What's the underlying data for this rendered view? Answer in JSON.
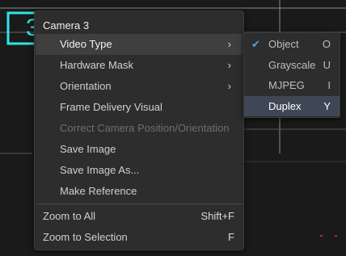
{
  "context_menu": {
    "title": "Camera 3",
    "items": [
      {
        "label": "Video Type",
        "has_submenu": true,
        "highlighted": true,
        "disabled": false
      },
      {
        "label": "Hardware Mask",
        "has_submenu": true,
        "highlighted": false,
        "disabled": false
      },
      {
        "label": "Orientation",
        "has_submenu": true,
        "highlighted": false,
        "disabled": false
      },
      {
        "label": "Frame Delivery Visual",
        "has_submenu": false,
        "highlighted": false,
        "disabled": false
      },
      {
        "label": "Correct Camera Position/Orientation",
        "has_submenu": false,
        "highlighted": false,
        "disabled": true
      },
      {
        "label": "Save Image",
        "has_submenu": false,
        "highlighted": false,
        "disabled": false
      },
      {
        "label": "Save Image As...",
        "has_submenu": false,
        "highlighted": false,
        "disabled": false
      },
      {
        "label": "Make Reference",
        "has_submenu": false,
        "highlighted": false,
        "disabled": false
      }
    ],
    "zoom_items": [
      {
        "label": "Zoom to All",
        "shortcut": "Shift+F"
      },
      {
        "label": "Zoom to Selection",
        "shortcut": "F"
      }
    ],
    "submenu_arrow": "›"
  },
  "video_type_submenu": {
    "items": [
      {
        "label": "Object",
        "key": "O",
        "checked": true,
        "highlighted": false
      },
      {
        "label": "Grayscale",
        "key": "U",
        "checked": false,
        "highlighted": false
      },
      {
        "label": "MJPEG",
        "key": "I",
        "checked": false,
        "highlighted": false
      },
      {
        "label": "Duplex",
        "key": "Y",
        "checked": false,
        "highlighted": true
      }
    ],
    "check_glyph": "✔"
  },
  "viewport": {
    "camera_badge_text": "3",
    "colors": {
      "background": "#1a1a1a",
      "grid": "#8a8a8a",
      "badge_border": "#2ee6e6",
      "marker": "#c0282d"
    }
  }
}
